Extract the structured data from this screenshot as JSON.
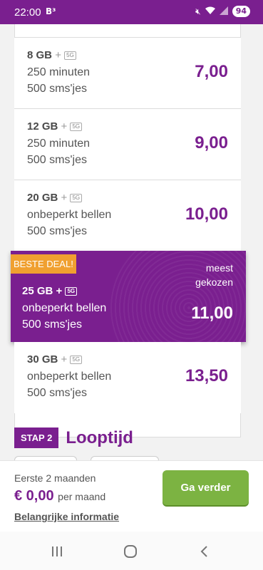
{
  "status": {
    "time": "22:00",
    "logo": "B³",
    "battery": "94"
  },
  "plans": [
    {
      "data": "8 GB",
      "plus": "+",
      "tag": "5G",
      "minutes": "250 minuten",
      "sms": "500 sms'jes",
      "price": "7,00"
    },
    {
      "data": "12 GB",
      "plus": "+",
      "tag": "5G",
      "minutes": "250 minuten",
      "sms": "500 sms'jes",
      "price": "9,00"
    },
    {
      "data": "20 GB",
      "plus": "+",
      "tag": "5G",
      "minutes": "onbeperkt bellen",
      "sms": "500 sms'jes",
      "price": "10,00"
    },
    {
      "data": "30 GB",
      "plus": "+",
      "tag": "5G",
      "minutes": "onbeperkt bellen",
      "sms": "500 sms'jes",
      "price": "13,50"
    }
  ],
  "deal": {
    "badge": "BESTE DEAL!",
    "meest1": "meest",
    "meest2": "gekozen",
    "data": "25 GB",
    "plus": "+",
    "tag": "5G",
    "minutes": "onbeperkt bellen",
    "sms": "500 sms'jes",
    "price": "11,00"
  },
  "step": {
    "tag": "STAP 2",
    "title": "Looptijd"
  },
  "bottom": {
    "label": "Eerste 2 maanden",
    "price": "€ 0,00",
    "per": "per maand",
    "info": "Belangrijke informatie",
    "button": "Ga verder"
  },
  "colors": {
    "brand": "#7a1f8f",
    "accent": "#f0a030",
    "cta": "#7cb342"
  }
}
